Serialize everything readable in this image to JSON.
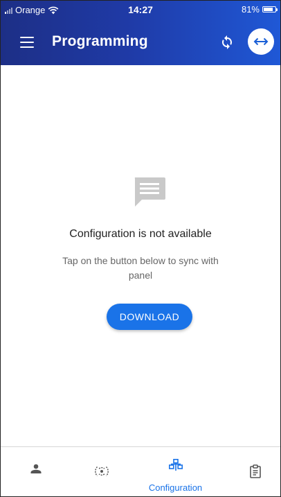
{
  "status_bar": {
    "carrier": "Orange",
    "time": "14:27",
    "battery": "81%",
    "battery_level": 0.81
  },
  "app_bar": {
    "title": "Programming",
    "menu_icon": "hamburger-menu-icon",
    "sync_icon": "sync-icon",
    "connect_icon": "left-right-arrow-icon"
  },
  "empty_state": {
    "icon": "message-icon",
    "title": "Configuration is not available",
    "subtitle": "Tap on the button below to sync with panel",
    "button_label": "DOWNLOAD"
  },
  "bottom_nav": {
    "items": [
      {
        "id": "user",
        "icon": "person-icon",
        "label": "",
        "active": false
      },
      {
        "id": "sensor",
        "icon": "sensor-icon",
        "label": "",
        "active": false
      },
      {
        "id": "configuration",
        "icon": "hierarchy-icon",
        "label": "Configuration",
        "active": true
      },
      {
        "id": "report",
        "icon": "clipboard-icon",
        "label": "",
        "active": false
      }
    ]
  },
  "colors": {
    "header_start": "#1d2f86",
    "header_end": "#1f58d6",
    "accent": "#1a73e8",
    "icon_gray": "#555555"
  }
}
